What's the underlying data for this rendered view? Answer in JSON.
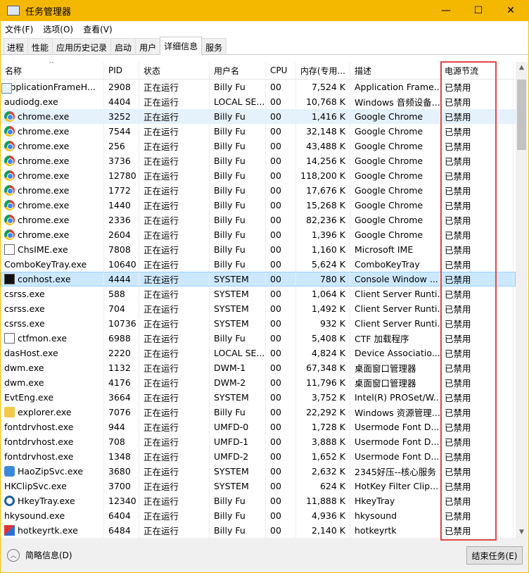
{
  "window": {
    "title": "任务管理器",
    "minimize": "—",
    "maximize": "☐",
    "close": "✕"
  },
  "menu": [
    "文件(F)",
    "选项(O)",
    "查看(V)"
  ],
  "tabs": [
    "进程",
    "性能",
    "应用历史记录",
    "启动",
    "用户",
    "详细信息",
    "服务"
  ],
  "active_tab": "详细信息",
  "columns": [
    "名称",
    "PID",
    "状态",
    "用户名",
    "CPU",
    "内存(专用...",
    "描述",
    "电源节流"
  ],
  "sort_indicator": "^",
  "rows": [
    [
      "win",
      "ApplicationFrameH...",
      "2908",
      "正在运行",
      "Billy Fu",
      "00",
      "7,524 K",
      "Application Frame...",
      "已禁用"
    ],
    [
      "win",
      "audiodg.exe",
      "4404",
      "正在运行",
      "LOCAL SE...",
      "00",
      "10,768 K",
      "Windows 音频设备...",
      "已禁用"
    ],
    [
      "chrome",
      "chrome.exe",
      "3252",
      "正在运行",
      "Billy Fu",
      "00",
      "1,416 K",
      "Google Chrome",
      "已禁用"
    ],
    [
      "chrome",
      "chrome.exe",
      "7544",
      "正在运行",
      "Billy Fu",
      "00",
      "32,148 K",
      "Google Chrome",
      "已禁用"
    ],
    [
      "chrome",
      "chrome.exe",
      "256",
      "正在运行",
      "Billy Fu",
      "00",
      "43,488 K",
      "Google Chrome",
      "已禁用"
    ],
    [
      "chrome",
      "chrome.exe",
      "3736",
      "正在运行",
      "Billy Fu",
      "00",
      "14,256 K",
      "Google Chrome",
      "已禁用"
    ],
    [
      "chrome",
      "chrome.exe",
      "12780",
      "正在运行",
      "Billy Fu",
      "00",
      "118,200 K",
      "Google Chrome",
      "已禁用"
    ],
    [
      "chrome",
      "chrome.exe",
      "1772",
      "正在运行",
      "Billy Fu",
      "00",
      "17,676 K",
      "Google Chrome",
      "已禁用"
    ],
    [
      "chrome",
      "chrome.exe",
      "1440",
      "正在运行",
      "Billy Fu",
      "00",
      "15,268 K",
      "Google Chrome",
      "已禁用"
    ],
    [
      "chrome",
      "chrome.exe",
      "2336",
      "正在运行",
      "Billy Fu",
      "00",
      "82,236 K",
      "Google Chrome",
      "已禁用"
    ],
    [
      "chrome",
      "chrome.exe",
      "2604",
      "正在运行",
      "Billy Fu",
      "00",
      "1,396 K",
      "Google Chrome",
      "已禁用"
    ],
    [
      "gen",
      "ChsIME.exe",
      "7808",
      "正在运行",
      "Billy Fu",
      "00",
      "1,160 K",
      "Microsoft IME",
      "已禁用"
    ],
    [
      "win",
      "ComboKeyTray.exe",
      "10640",
      "正在运行",
      "Billy Fu",
      "00",
      "5,624 K",
      "ComboKeyTray",
      "已禁用"
    ],
    [
      "con",
      "conhost.exe",
      "4444",
      "正在运行",
      "SYSTEM",
      "00",
      "780 K",
      "Console Window ...",
      "已禁用"
    ],
    [
      "win",
      "csrss.exe",
      "588",
      "正在运行",
      "SYSTEM",
      "00",
      "1,064 K",
      "Client Server Runti...",
      "已禁用"
    ],
    [
      "win",
      "csrss.exe",
      "704",
      "正在运行",
      "SYSTEM",
      "00",
      "1,492 K",
      "Client Server Runti...",
      "已禁用"
    ],
    [
      "win",
      "csrss.exe",
      "10736",
      "正在运行",
      "SYSTEM",
      "00",
      "932 K",
      "Client Server Runti...",
      "已禁用"
    ],
    [
      "gen",
      "ctfmon.exe",
      "6988",
      "正在运行",
      "Billy Fu",
      "00",
      "5,408 K",
      "CTF 加载程序",
      "已禁用"
    ],
    [
      "win",
      "dasHost.exe",
      "2220",
      "正在运行",
      "LOCAL SE...",
      "00",
      "4,824 K",
      "Device Associatio...",
      "已禁用"
    ],
    [
      "win",
      "dwm.exe",
      "1132",
      "正在运行",
      "DWM-1",
      "00",
      "67,348 K",
      "桌面窗口管理器",
      "已禁用"
    ],
    [
      "win",
      "dwm.exe",
      "4176",
      "正在运行",
      "DWM-2",
      "00",
      "11,796 K",
      "桌面窗口管理器",
      "已禁用"
    ],
    [
      "win",
      "EvtEng.exe",
      "3664",
      "正在运行",
      "SYSTEM",
      "00",
      "3,752 K",
      "Intel(R) PROSet/W...",
      "已禁用"
    ],
    [
      "folder",
      "explorer.exe",
      "7076",
      "正在运行",
      "Billy Fu",
      "00",
      "22,292 K",
      "Windows 资源管理...",
      "已禁用"
    ],
    [
      "win",
      "fontdrvhost.exe",
      "944",
      "正在运行",
      "UMFD-0",
      "00",
      "1,728 K",
      "Usermode Font D...",
      "已禁用"
    ],
    [
      "win",
      "fontdrvhost.exe",
      "708",
      "正在运行",
      "UMFD-1",
      "00",
      "3,888 K",
      "Usermode Font D...",
      "已禁用"
    ],
    [
      "win",
      "fontdrvhost.exe",
      "1348",
      "正在运行",
      "UMFD-2",
      "00",
      "1,652 K",
      "Usermode Font D...",
      "已禁用"
    ],
    [
      "hz",
      "HaoZipSvc.exe",
      "3680",
      "正在运行",
      "SYSTEM",
      "00",
      "2,632 K",
      "2345好压--核心服务",
      "已禁用"
    ],
    [
      "win",
      "HKClipSvc.exe",
      "3700",
      "正在运行",
      "SYSTEM",
      "00",
      "624 K",
      "HotKey Filter Clip...",
      "已禁用"
    ],
    [
      "hk",
      "HkeyTray.exe",
      "12340",
      "正在运行",
      "Billy Fu",
      "00",
      "11,888 K",
      "HkeyTray",
      "已禁用"
    ],
    [
      "win",
      "hkysound.exe",
      "6404",
      "正在运行",
      "Billy Fu",
      "00",
      "4,936 K",
      "hkysound",
      "已禁用"
    ],
    [
      "rt",
      "hotkeyrtk.exe",
      "6484",
      "正在运行",
      "Billy Fu",
      "00",
      "2,140 K",
      "hotkeyrtk",
      "已禁用"
    ]
  ],
  "hover_row": 2,
  "selected_row": 13,
  "footer": {
    "fewer_details": "简略信息(D)",
    "end_task": "结束任务(E)"
  },
  "colors": {
    "title_bar": "#f5b800",
    "highlight_box": "#e04848",
    "selected": "#cce8ff"
  }
}
